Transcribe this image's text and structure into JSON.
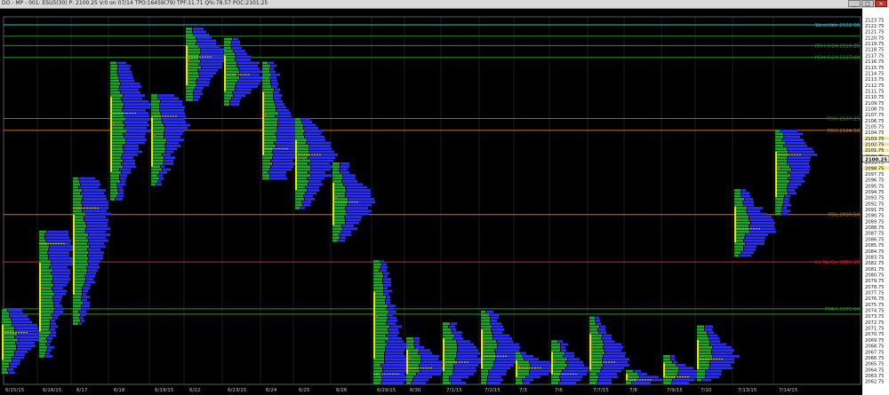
{
  "window": {
    "title": "DO - MP - 001: ESU5(30) P: 2100.25 V:0 on 07/14 TPO:16459(79)  TPF:11.71 Q%:78.57 POC:2101.25",
    "buttons": [
      "minimize-button",
      "maximize-button",
      "close-button"
    ]
  },
  "chart_data": {
    "type": "market-profile",
    "instrument": "ESU5(30)",
    "y_ticks": [
      "2123.75",
      "2122.75",
      "2121.75",
      "2120.75",
      "2119.75",
      "2118.75",
      "2117.75",
      "2116.75",
      "2115.75",
      "2114.75",
      "2113.75",
      "2112.75",
      "2111.75",
      "2110.75",
      "2109.75",
      "2108.75",
      "2107.75",
      "2106.75",
      "2105.75",
      "2104.75",
      "2103.75",
      "2102.75",
      "2101.75",
      "2100.75",
      "2099.75",
      "2098.75",
      "2097.75",
      "2096.75",
      "2095.75",
      "2094.75",
      "2093.75",
      "2092.75",
      "2091.75",
      "2090.75",
      "2089.75",
      "2088.75",
      "2087.75",
      "2086.75",
      "2085.75",
      "2084.75",
      "2083.75",
      "2082.75",
      "2081.75",
      "2080.75",
      "2079.75",
      "2078.75",
      "2077.75",
      "2076.75",
      "2075.75",
      "2074.75",
      "2073.75",
      "2072.75",
      "2071.75",
      "2070.75",
      "2069.75",
      "2068.75",
      "2067.75",
      "2066.75",
      "2065.75",
      "2064.75",
      "2063.75",
      "2062.75"
    ],
    "ylim": [
      2062.25,
      2124.25
    ],
    "current_price": 2100.25,
    "highlight_ticks": [
      "2103.75",
      "2102.75",
      "2101.75",
      "2100.75",
      "2099.75",
      "2098.75"
    ],
    "x_labels": [
      {
        "label": "6/15/15",
        "slot": 0
      },
      {
        "label": "6/16/15",
        "slot": 1
      },
      {
        "label": "6/17",
        "slot": 2
      },
      {
        "label": "6/18",
        "slot": 3
      },
      {
        "label": "6/19/15",
        "slot": 4
      },
      {
        "label": "6/22",
        "slot": 5
      },
      {
        "label": "6/23/15",
        "slot": 6
      },
      {
        "label": "6/24",
        "slot": 7
      },
      {
        "label": "6/25",
        "slot": 8
      },
      {
        "label": "6/26",
        "slot": 9
      },
      {
        "label": "6/29/15",
        "slot": 10
      },
      {
        "label": "6/30",
        "slot": 11
      },
      {
        "label": "7/1/15",
        "slot": 12
      },
      {
        "label": "7/2/15",
        "slot": 13
      },
      {
        "label": "7/3",
        "slot": 14
      },
      {
        "label": "7/6",
        "slot": 15
      },
      {
        "label": "7/7/15",
        "slot": 16
      },
      {
        "label": "7/8",
        "slot": 17
      },
      {
        "label": "7/9/15",
        "slot": 18
      },
      {
        "label": "7/10",
        "slot": 19
      },
      {
        "label": "7/13/15",
        "slot": 20
      },
      {
        "label": "7/14/15",
        "slot": 21
      }
    ],
    "levels": [
      {
        "price": 2122.9,
        "color": "#20c8c8",
        "label": "WeekVah:2122.50"
      },
      {
        "price": 2121.0,
        "color": "#1f8a1f",
        "label": ""
      },
      {
        "price": 2119.4,
        "color": "#1f9e1f",
        "label": "PDH:6/24 2119.25"
      },
      {
        "price": 2117.4,
        "color": "#1f9e1f",
        "label": "PDH:6/24 2117.00"
      },
      {
        "price": 2107.1,
        "color": "#1f9e1f",
        "label": "PDH:2107.25"
      },
      {
        "price": 2105.1,
        "color": "#c8781e",
        "label": "PDH:2104.50"
      },
      {
        "price": 2090.9,
        "color": "#c8781e",
        "label": "PDL:2090.50"
      },
      {
        "price": 2082.9,
        "color": "#e02020",
        "label": "Go No/Go 2083.25"
      },
      {
        "price": 2075.0,
        "color": "#1f9e1f",
        "label": "PVAH:2075.00"
      },
      {
        "price": 2074.1,
        "color": "#1f9e1f",
        "label": ""
      }
    ],
    "profiles": [
      {
        "x": 2,
        "lo": 2064.25,
        "hi": 2075.0,
        "poc": 2071.0
      },
      {
        "x": 44,
        "lo": 2067.0,
        "hi": 2088.0,
        "poc": 2086.0
      },
      {
        "x": 82,
        "lo": 2072.5,
        "hi": 2097.0,
        "poc": 2092.0
      },
      {
        "x": 124,
        "lo": 2093.5,
        "hi": 2116.5,
        "poc": 2108.0
      },
      {
        "x": 170,
        "lo": 2096.0,
        "hi": 2111.0,
        "poc": 2107.5
      },
      {
        "x": 209,
        "lo": 2110.25,
        "hi": 2122.5,
        "poc": 2117.5
      },
      {
        "x": 252,
        "lo": 2109.5,
        "hi": 2120.5,
        "poc": 2114.5
      },
      {
        "x": 295,
        "lo": 2097.0,
        "hi": 2116.5,
        "poc": 2102.0
      },
      {
        "x": 332,
        "lo": 2092.0,
        "hi": 2107.25,
        "poc": 2101.0
      },
      {
        "x": 374,
        "lo": 2086.5,
        "hi": 2099.5,
        "poc": 2093.0
      },
      {
        "x": 420,
        "lo": 2062.5,
        "hi": 2083.0,
        "poc": 2064.0
      },
      {
        "x": 457,
        "lo": 2062.5,
        "hi": 2070.0,
        "poc": 2065.0
      },
      {
        "x": 498,
        "lo": 2062.5,
        "hi": 2072.5,
        "poc": 2066.0
      },
      {
        "x": 541,
        "lo": 2062.5,
        "hi": 2074.5,
        "poc": 2067.0
      },
      {
        "x": 580,
        "lo": 2062.5,
        "hi": 2067.5,
        "poc": 2065.0
      },
      {
        "x": 620,
        "lo": 2062.5,
        "hi": 2069.5,
        "poc": 2064.0
      },
      {
        "x": 663,
        "lo": 2062.5,
        "hi": 2073.5,
        "poc": 2066.0
      },
      {
        "x": 704,
        "lo": 2062.5,
        "hi": 2064.5,
        "poc": 2063.0
      },
      {
        "x": 746,
        "lo": 2062.5,
        "hi": 2067.0,
        "poc": 2063.5
      },
      {
        "x": 784,
        "lo": 2063.0,
        "hi": 2072.0,
        "poc": 2066.5
      },
      {
        "x": 826,
        "lo": 2084.0,
        "hi": 2095.0,
        "poc": 2088.5
      },
      {
        "x": 872,
        "lo": 2091.0,
        "hi": 2105.0,
        "poc": 2101.0
      }
    ]
  }
}
